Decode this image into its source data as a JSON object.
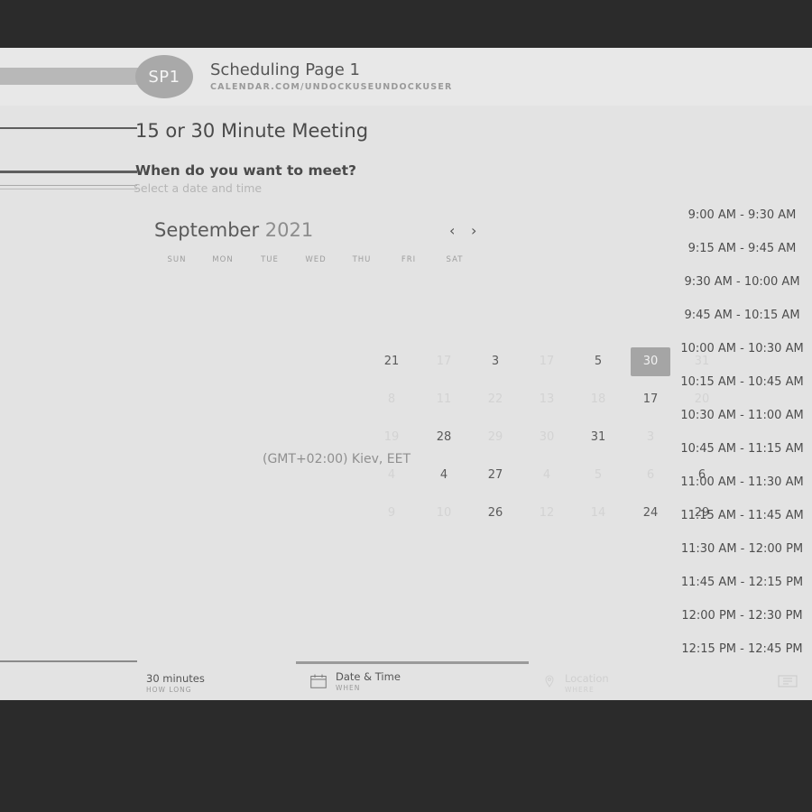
{
  "header": {
    "avatar_initials": "SP1",
    "page_name": "Scheduling Page 1",
    "page_url": "CALENDAR.COM/UNDOCKUSEUNDOCKUSER"
  },
  "meeting": {
    "title": "15 or 30 Minute Meeting",
    "question": "When do you want to meet?",
    "subtitle": "Select a date and time"
  },
  "calendar": {
    "month": "September",
    "year": "2021",
    "prev_icon": "‹",
    "next_icon": "›",
    "weekdays": [
      "SUN",
      "MON",
      "TUE",
      "WED",
      "THU",
      "FRI",
      "SAT"
    ],
    "days": [
      {
        "label": "21",
        "state": "normal"
      },
      {
        "label": "17",
        "state": "faint"
      },
      {
        "label": "3",
        "state": "normal"
      },
      {
        "label": "17",
        "state": "faint"
      },
      {
        "label": "5",
        "state": "normal"
      },
      {
        "label": "30",
        "state": "selected"
      },
      {
        "label": "31",
        "state": "faint"
      },
      {
        "label": "8",
        "state": "faint"
      },
      {
        "label": "11",
        "state": "faint"
      },
      {
        "label": "22",
        "state": "faint"
      },
      {
        "label": "13",
        "state": "faint"
      },
      {
        "label": "18",
        "state": "faint"
      },
      {
        "label": "17",
        "state": "normal"
      },
      {
        "label": "20",
        "state": "faint"
      },
      {
        "label": "19",
        "state": "faint"
      },
      {
        "label": "28",
        "state": "normal"
      },
      {
        "label": "29",
        "state": "faint"
      },
      {
        "label": "30",
        "state": "faint"
      },
      {
        "label": "31",
        "state": "normal"
      },
      {
        "label": "3",
        "state": "faint"
      },
      {
        "label": "4",
        "state": "faint"
      },
      {
        "label": "4",
        "state": "normal"
      },
      {
        "label": "27",
        "state": "normal"
      },
      {
        "label": "4",
        "state": "faint"
      },
      {
        "label": "5",
        "state": "faint"
      },
      {
        "label": "6",
        "state": "faint"
      },
      {
        "label": "6",
        "state": "normal"
      },
      {
        "label": "9",
        "state": "faint"
      },
      {
        "label": "10",
        "state": "faint"
      },
      {
        "label": "26",
        "state": "normal"
      },
      {
        "label": "12",
        "state": "faint"
      },
      {
        "label": "14",
        "state": "faint"
      },
      {
        "label": "24",
        "state": "normal"
      },
      {
        "label": "29",
        "state": "normal"
      }
    ],
    "timezone": "(GMT+02:00) Kiev, EET"
  },
  "time_slots": [
    "9:00 AM - 9:30 AM",
    "9:15 AM - 9:45 AM",
    "9:30 AM - 10:00 AM",
    "9:45 AM - 10:15 AM",
    "10:00 AM - 10:30 AM",
    "10:15 AM - 10:45 AM",
    "10:30 AM - 11:00 AM",
    "10:45 AM - 11:15 AM",
    "11:00 AM - 11:30 AM",
    "11:15 AM - 11:45 AM",
    "11:30 AM - 12:00 PM",
    "11:45 AM - 12:15 PM",
    "12:00 PM - 12:30 PM",
    "12:15 PM - 12:45 PM"
  ],
  "footer": {
    "duration": "30 minutes",
    "duration_sub": "HOW LONG",
    "datetime": "Date & Time",
    "datetime_sub": "WHEN",
    "location": "Location",
    "location_sub": "WHERE"
  },
  "icons": {
    "calendar": "calendar-icon",
    "location": "location-pin-icon",
    "details": "details-icon"
  }
}
